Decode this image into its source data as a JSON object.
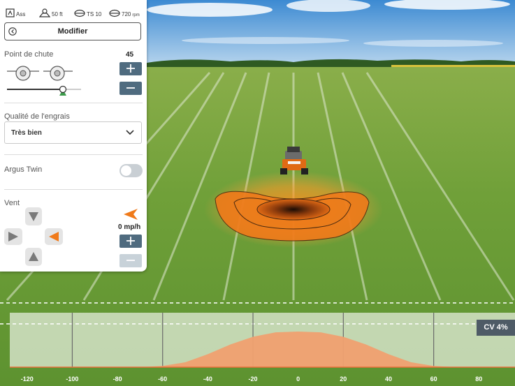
{
  "status_bar": {
    "mode": "Ass",
    "width": "50 ft",
    "disc": "TS 10",
    "speed": "720",
    "speed_unit": "rpm"
  },
  "panel": {
    "modify_label": "Modifier",
    "drop_point": {
      "label": "Point de chute",
      "value": "45"
    },
    "fertilizer_quality": {
      "label": "Qualité de l'engrais",
      "selected": "Très bien"
    },
    "argus_twin": {
      "label": "Argus Twin",
      "enabled": false
    },
    "wind": {
      "label": "Vent",
      "value": "0 mp/h",
      "direction": "left"
    }
  },
  "chart_data": {
    "type": "area",
    "x_ticks": [
      "-120",
      "-100",
      "-80",
      "-60",
      "-40",
      "-20",
      "0",
      "20",
      "40",
      "60",
      "80"
    ],
    "cv_label": "CV 4%",
    "x": [
      -130,
      -70,
      -60,
      -50,
      -40,
      -30,
      -20,
      -10,
      0,
      10,
      20,
      30,
      40,
      50,
      60,
      70,
      100
    ],
    "values": [
      0,
      0,
      3,
      12,
      32,
      56,
      75,
      86,
      88,
      86,
      75,
      56,
      32,
      12,
      3,
      0,
      0
    ],
    "xlim": [
      -132,
      96
    ],
    "ylim": [
      0,
      100
    ]
  },
  "colors": {
    "accent": "#4f6b7f",
    "orange": "#f07a1a",
    "distribution_fill": "#f0a070"
  }
}
